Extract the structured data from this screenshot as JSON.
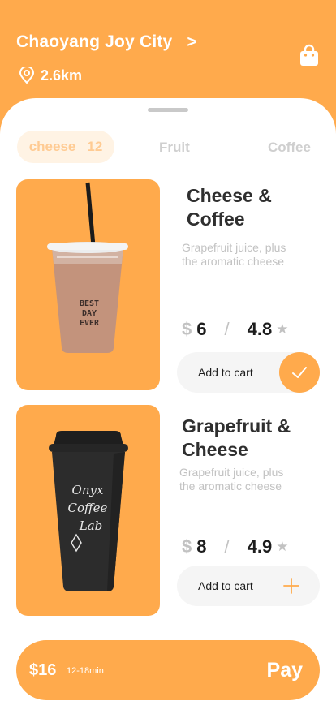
{
  "header": {
    "store_name": "Chaoyang Joy City",
    "store_arrow": ">",
    "distance": "2.6km",
    "icons": [
      "location-pin-icon",
      "shopping-bag-icon"
    ]
  },
  "tabs": [
    {
      "label": "cheese",
      "count": "12",
      "active": true
    },
    {
      "label": "Fruit",
      "active": false
    },
    {
      "label": "Coffee",
      "active": false
    }
  ],
  "products": [
    {
      "title_line1": "Cheese &",
      "title_line2": "Coffee",
      "desc_line1": "Grapefruit  juice, plus",
      "desc_line2": "the aromatic cheese",
      "currency": "$",
      "price": "6",
      "separator": "/",
      "rating": "4.8",
      "cart_label": "Add to cart",
      "cup_text": [
        "BEST",
        "DAY",
        "EVER"
      ],
      "added": true
    },
    {
      "title_line1": "Grapefruit &",
      "title_line2": "Cheese",
      "desc_line1": "Grapefruit  juice, plus",
      "desc_line2": "the aromatic cheese",
      "currency": "$",
      "price": "8",
      "separator": "/",
      "rating": "4.9",
      "cart_label": "Add to cart",
      "cup_text": [
        "Onyx",
        "Coffee",
        "Lab"
      ],
      "added": false
    }
  ],
  "checkout": {
    "total": "$16",
    "eta": "12-18min",
    "pay_label": "Pay"
  },
  "colors": {
    "accent": "#FFAA4C",
    "tab_bg": "#FFF3E4",
    "tab_text": "#FFCB93",
    "muted": "#C2C2C2",
    "cart_bg": "#F5F5F5"
  }
}
